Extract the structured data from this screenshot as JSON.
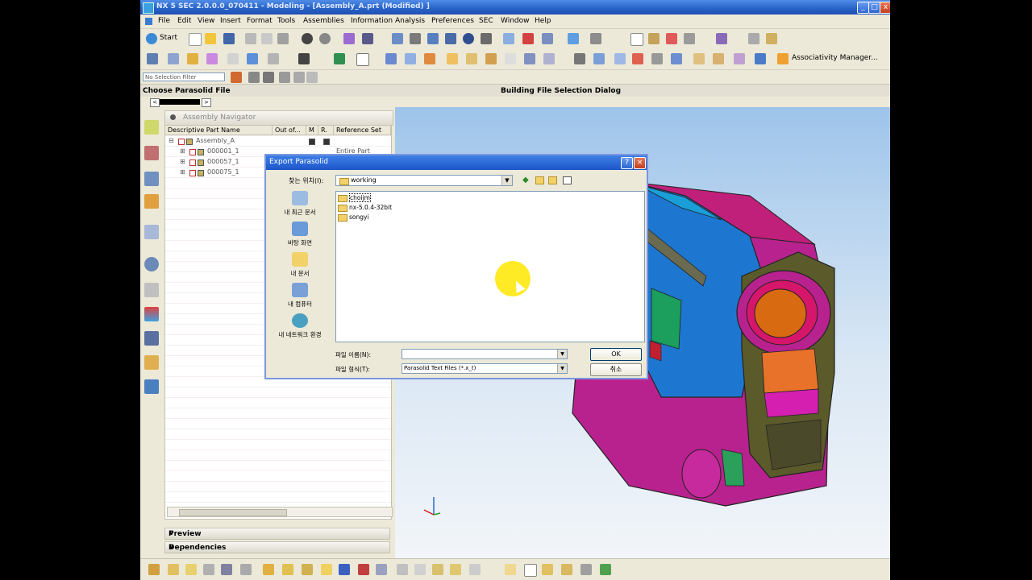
{
  "window": {
    "title": "NX 5 SEC 2.0.0.0_070411 - Modeling - [Assembly_A.prt (Modified) ]",
    "controls": [
      "_",
      "□",
      "x"
    ]
  },
  "menu": [
    "File",
    "Edit",
    "View",
    "Insert",
    "Format",
    "Tools",
    "Assemblies",
    "Information",
    "Analysis",
    "Preferences",
    "SEC",
    "Window",
    "Help"
  ],
  "toolbar": {
    "start_label": "Start",
    "associativity_label": "Associativity Manager..."
  },
  "selection_bar": {
    "filter_value": "No Selection Filter"
  },
  "cue_line": {
    "left": "Choose Parasolid File",
    "center": "Building File Selection Dialog"
  },
  "navigator": {
    "title": "Assembly Navigator",
    "columns": [
      "Descriptive Part Name",
      "Out of...",
      "M",
      "R.",
      "Reference Set"
    ],
    "rows": [
      {
        "name": "Assembly_A",
        "reference": ""
      },
      {
        "name": "000001_1",
        "reference": "Entire Part"
      },
      {
        "name": "000057_1",
        "reference": ""
      },
      {
        "name": "000075_1",
        "reference": ""
      }
    ],
    "sections": [
      "Preview",
      "Dependencies"
    ]
  },
  "dialog": {
    "title": "Export Parasolid",
    "look_in_label": "찾는 위치(I):",
    "look_in_value": "working",
    "places": [
      "내 최근 문서",
      "바탕 화면",
      "내 문서",
      "내 컴퓨터",
      "내 네트워크 환경"
    ],
    "files": [
      "choijm",
      "nx-5.0.4-32bit",
      "songyi"
    ],
    "filename_label": "파일 이름(N):",
    "filename_value": "",
    "filetype_label": "파일 형식(T):",
    "filetype_value": "Parasolid Text Files (*.x_t)",
    "ok_label": "OK",
    "cancel_label": "취소"
  },
  "colors": {
    "title_blue": "#2a64c9",
    "body_magenta": "#b8228e",
    "body_blue": "#1d77d0",
    "lens_orange": "#d86a12",
    "lens_ring": "#d5166a",
    "grip_olive": "#5b5a2a"
  }
}
